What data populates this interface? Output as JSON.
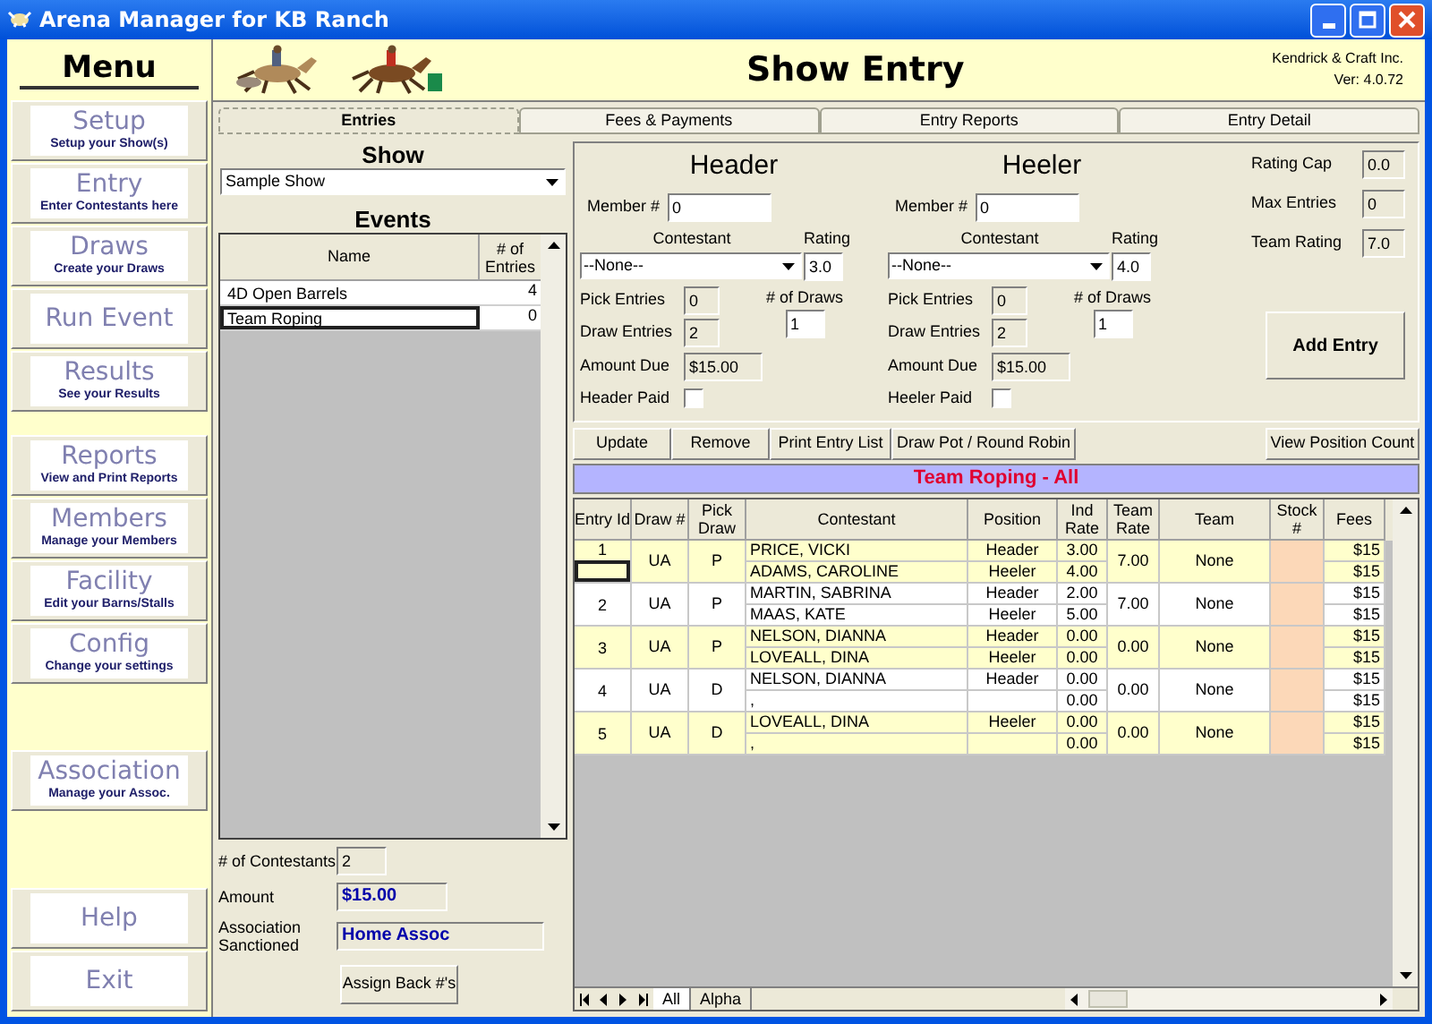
{
  "window": {
    "title": "Arena Manager for KB Ranch"
  },
  "menu": {
    "title": "Menu",
    "groups": [
      [
        {
          "label": "Setup",
          "subtitle": "Setup your Show(s)"
        },
        {
          "label": "Entry",
          "subtitle": "Enter Contestants here"
        },
        {
          "label": "Draws",
          "subtitle": "Create your Draws"
        },
        {
          "label": "Run Event"
        },
        {
          "label": "Results",
          "subtitle": "See your Results"
        }
      ],
      [
        {
          "label": "Reports",
          "subtitle": "View and Print Reports"
        },
        {
          "label": "Members",
          "subtitle": "Manage your Members"
        },
        {
          "label": "Facility",
          "subtitle": "Edit your Barns/Stalls"
        },
        {
          "label": "Config",
          "subtitle": "Change your settings"
        }
      ],
      [
        {
          "label": "Association",
          "subtitle": "Manage your Assoc."
        }
      ],
      [
        {
          "label": "Help"
        },
        {
          "label": "Exit"
        }
      ]
    ]
  },
  "header": {
    "title": "Show Entry",
    "company": "Kendrick & Craft Inc.",
    "version": "Ver: 4.0.72"
  },
  "tabs": [
    {
      "label": "Entries",
      "selected": true
    },
    {
      "label": "Fees & Payments",
      "selected": false
    },
    {
      "label": "Entry Reports",
      "selected": false
    },
    {
      "label": "Entry Detail",
      "selected": false
    }
  ],
  "show": {
    "label": "Show",
    "value": "Sample Show"
  },
  "events": {
    "title": "Events",
    "columns": [
      "Name",
      "# of Entries"
    ],
    "rows": [
      {
        "name": "4D Open Barrels",
        "entries": "4",
        "selected": false
      },
      {
        "name": "Team Roping",
        "entries": "0",
        "selected": true
      }
    ]
  },
  "summary": [
    {
      "label": "# of Contestants",
      "value": "2",
      "kind": "small"
    },
    {
      "label": "Amount",
      "value": "$15.00",
      "kind": "medium"
    },
    {
      "label": "Association Sanctioned",
      "value": "Home Assoc",
      "kind": "wide"
    }
  ],
  "assign_button": "Assign Back #'s",
  "roles": [
    {
      "title": "Header",
      "member_label": "Member #",
      "member": "0",
      "contestant_label": "Contestant",
      "contestant": "--None--",
      "rating_label": "Rating",
      "rating": "3.0",
      "pick_label": "Pick Entries",
      "pick": "0",
      "draws_label": "# of Draws",
      "draws": "1",
      "draw_entries_label": "Draw Entries",
      "draw_entries": "2",
      "amount_label": "Amount Due",
      "amount": "$15.00",
      "paid_label": "Header Paid",
      "paid": false
    },
    {
      "title": "Heeler",
      "member_label": "Member #",
      "member": "0",
      "contestant_label": "Contestant",
      "contestant": "--None--",
      "rating_label": "Rating",
      "rating": "4.0",
      "pick_label": "Pick Entries",
      "pick": "0",
      "draws_label": "# of Draws",
      "draws": "1",
      "draw_entries_label": "Draw Entries",
      "draw_entries": "2",
      "amount_label": "Amount Due",
      "amount": "$15.00",
      "paid_label": "Heeler Paid",
      "paid": false
    }
  ],
  "limits": [
    {
      "label": "Rating Cap",
      "value": "0.0"
    },
    {
      "label": "Max Entries",
      "value": "0"
    },
    {
      "label": "Team Rating",
      "value": "7.0"
    }
  ],
  "add_button": "Add Entry",
  "actions": [
    "Update",
    "Remove",
    "Print Entry List",
    "Draw Pot / Round Robin"
  ],
  "view_button": "View Position Count",
  "grid": {
    "title": "Team Roping - All",
    "columns": [
      "Entry Id",
      "Draw #",
      "Pick Draw",
      "Contestant",
      "Position",
      "Ind Rate",
      "Team Rate",
      "Team",
      "Stock #",
      "Fees"
    ],
    "entries": [
      {
        "id": "1",
        "draw": "UA",
        "pick": "P",
        "team_rate": "7.00",
        "team": "None",
        "selected": true,
        "contestants": [
          {
            "name": "PRICE, VICKI",
            "position": "Header",
            "rate": "3.00",
            "fee": "$15"
          },
          {
            "name": "ADAMS, CAROLINE",
            "position": "Heeler",
            "rate": "4.00",
            "fee": "$15"
          }
        ]
      },
      {
        "id": "2",
        "draw": "UA",
        "pick": "P",
        "team_rate": "7.00",
        "team": "None",
        "selected": false,
        "contestants": [
          {
            "name": "MARTIN, SABRINA",
            "position": "Header",
            "rate": "2.00",
            "fee": "$15"
          },
          {
            "name": "MAAS, KATE",
            "position": "Heeler",
            "rate": "5.00",
            "fee": "$15"
          }
        ]
      },
      {
        "id": "3",
        "draw": "UA",
        "pick": "P",
        "team_rate": "0.00",
        "team": "None",
        "selected": false,
        "contestants": [
          {
            "name": "NELSON, DIANNA",
            "position": "Header",
            "rate": "0.00",
            "fee": "$15"
          },
          {
            "name": "LOVEALL, DINA",
            "position": "Heeler",
            "rate": "0.00",
            "fee": "$15"
          }
        ]
      },
      {
        "id": "4",
        "draw": "UA",
        "pick": "D",
        "team_rate": "0.00",
        "team": "None",
        "selected": false,
        "contestants": [
          {
            "name": "NELSON, DIANNA",
            "position": "Header",
            "rate": "0.00",
            "fee": "$15"
          },
          {
            "name": ",",
            "rate": "0.00",
            "fee": "$15"
          }
        ]
      },
      {
        "id": "5",
        "draw": "UA",
        "pick": "D",
        "team_rate": "0.00",
        "team": "None",
        "selected": false,
        "contestants": [
          {
            "name": "LOVEALL, DINA",
            "position": "Heeler",
            "rate": "0.00",
            "fee": "$15"
          },
          {
            "name": ",",
            "rate": "0.00",
            "fee": "$15"
          }
        ]
      }
    ]
  },
  "sheet_tabs": [
    {
      "label": "All",
      "selected": true
    },
    {
      "label": "Alpha",
      "selected": false
    }
  ]
}
